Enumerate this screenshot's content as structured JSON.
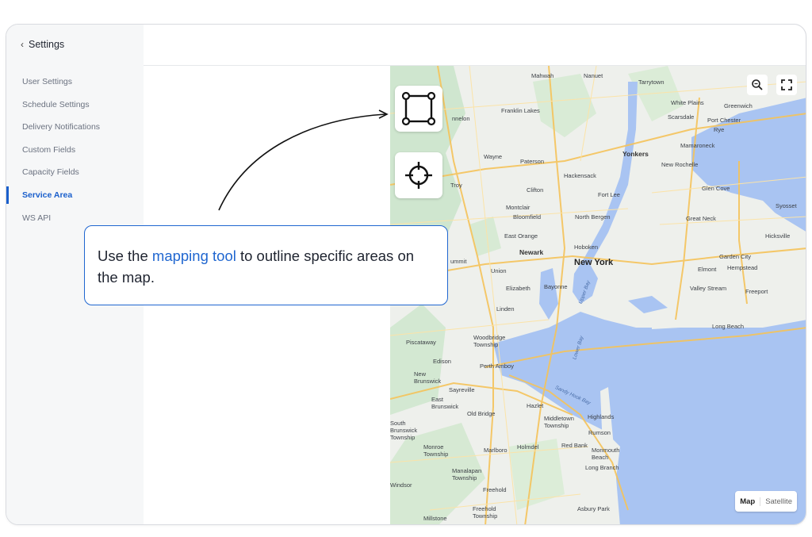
{
  "sidebar": {
    "back_label": "Settings",
    "items": [
      {
        "label": "User Settings"
      },
      {
        "label": "Schedule Settings"
      },
      {
        "label": "Delivery Notifications"
      },
      {
        "label": "Custom Fields"
      },
      {
        "label": "Capacity Fields"
      },
      {
        "label": "Service Area",
        "active": true
      },
      {
        "label": "WS API"
      }
    ]
  },
  "callout": {
    "text_before": "Use the ",
    "highlight": "mapping tool",
    "text_after": " to outline specific areas on the map."
  },
  "map": {
    "type_control": {
      "map_label": "Map",
      "satellite_label": "Satellite"
    },
    "labels": {
      "mahwah": "Mahwah",
      "nanuet": "Nanuet",
      "tarrytown": "Tarrytown",
      "white_plains": "White Plains",
      "greenwich": "Greenwich",
      "franklin_lakes": "Franklin Lakes",
      "scarsdale": "Scarsdale",
      "port_chester": "Port Chester",
      "rye": "Rye",
      "mamaroneck": "Mamaroneck",
      "wayne": "Wayne",
      "paterson": "Paterson",
      "yonkers": "Yonkers",
      "new_rochelle": "New Rochelle",
      "hackensack": "Hackensack",
      "clifton": "Clifton",
      "fort_lee": "Fort Lee",
      "glen_cove": "Glen Cove",
      "syosset": "Syosset",
      "montclair": "Montclair",
      "bloomfield": "Bloomfield",
      "great_neck": "Great Neck",
      "north_bergen": "North Bergen",
      "east_orange": "East Orange",
      "hicksville": "Hicksville",
      "newark": "Newark",
      "hoboken": "Hoboken",
      "new_york": "New York",
      "union": "Union",
      "garden_city": "Garden City",
      "elmont": "Elmont",
      "hempstead": "Hempstead",
      "elizabeth": "Elizabeth",
      "bayonne": "Bayonne",
      "valley_stream": "Valley Stream",
      "freeport": "Freeport",
      "linden": "Linden",
      "long_beach": "Long Beach",
      "piscataway": "Piscataway",
      "woodbridge": "Woodbridge Township",
      "edison": "Edison",
      "perth_amboy": "Perth Amboy",
      "new_brunswick": "New Brunswick",
      "sayreville": "Sayreville",
      "east_brunswick": "East Brunswick",
      "old_bridge": "Old Bridge",
      "hazlet": "Hazlet",
      "middletown": "Middletown Township",
      "highlands": "Highlands",
      "south_brunswick": "South Brunswick Township",
      "monroe": "Monroe Township",
      "marlboro": "Marlboro",
      "holmdel": "Holmdel",
      "red_bank": "Red Bank",
      "rumson": "Rumson",
      "monmouth_beach": "Monmouth Beach",
      "long_branch": "Long Branch",
      "manalapan": "Manalapan Township",
      "windsor": "Windsor",
      "freehold": "Freehold",
      "freehold_twp": "Freehold Township",
      "asbury_park": "Asbury Park",
      "millstone": "Millstone",
      "lower_bay": "Lower Bay",
      "sandy_hook_bay": "Sandy Hook Bay",
      "upper_bay": "Upper Bay",
      "pinnelon": "nnelon",
      "troy": "Troy",
      "ummit": "ummit"
    }
  }
}
